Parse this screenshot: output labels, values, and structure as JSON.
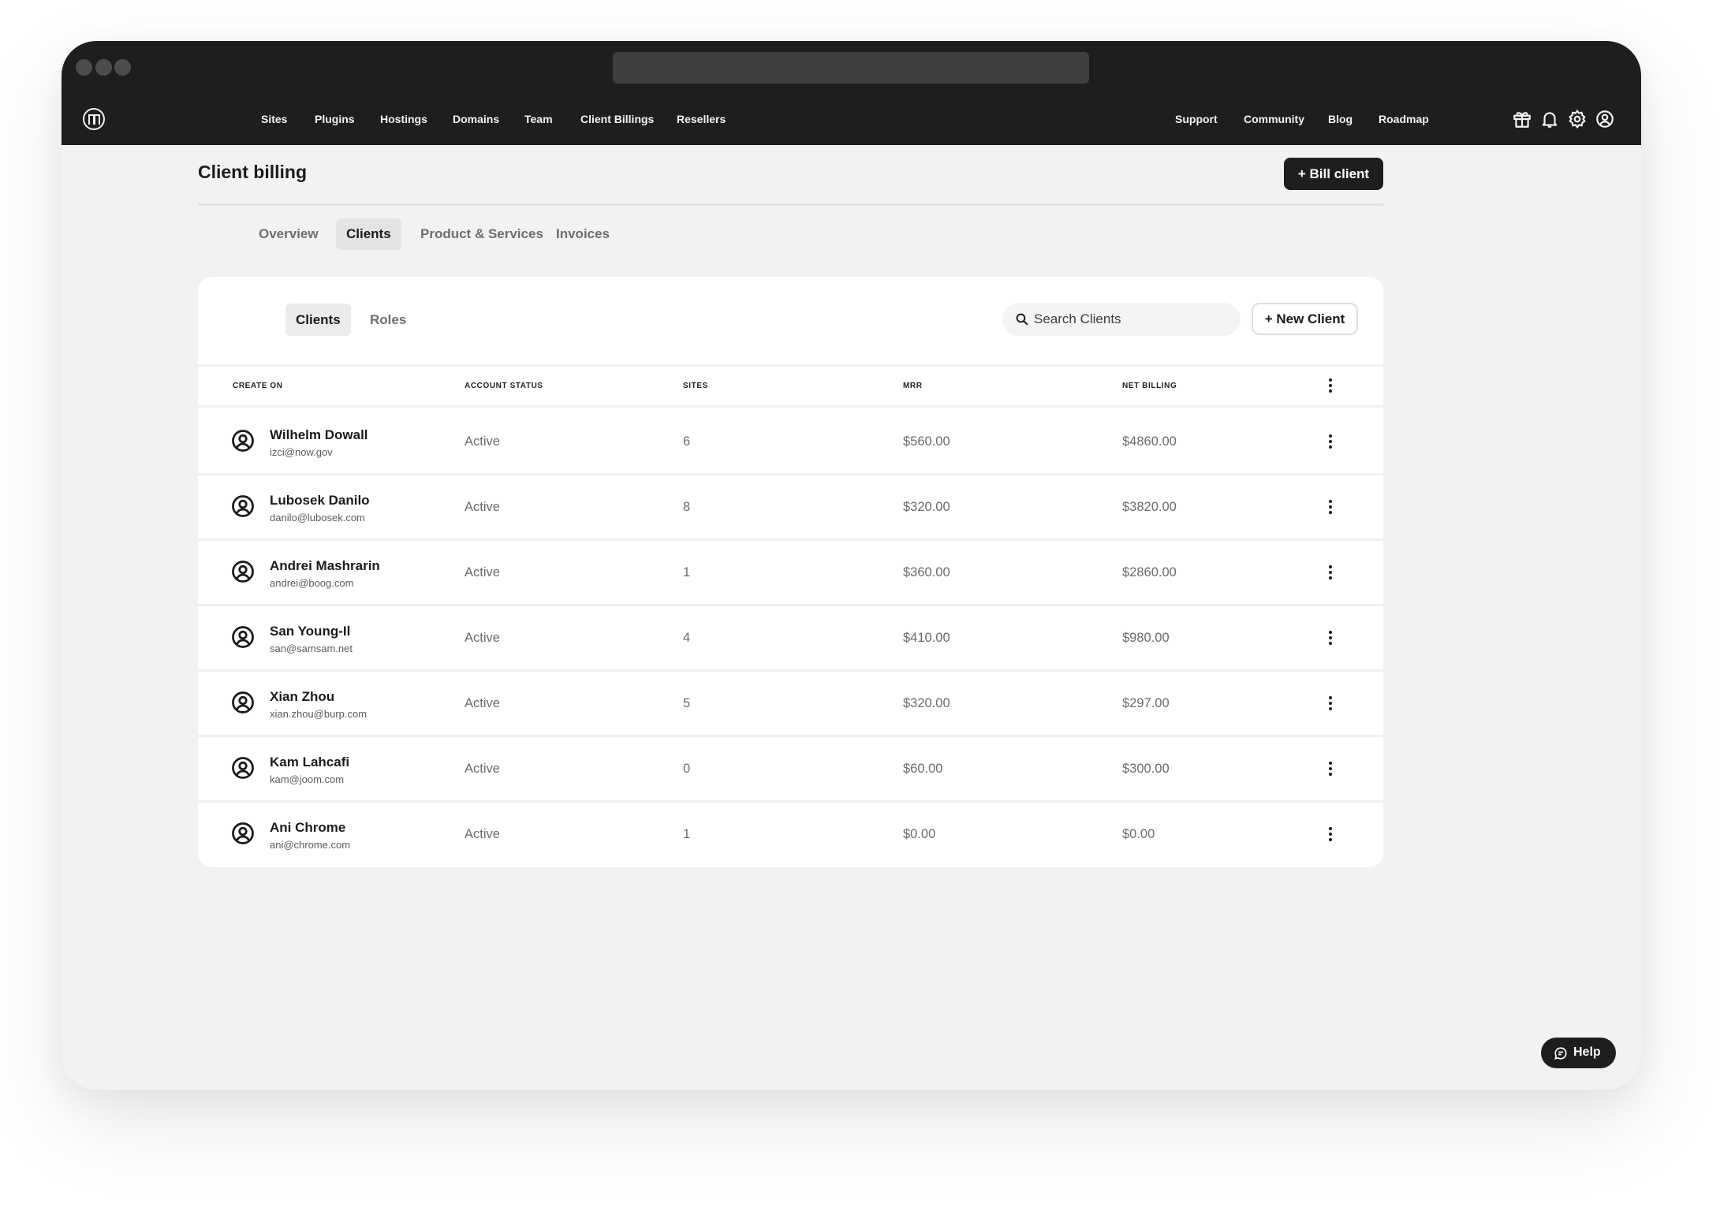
{
  "nav": {
    "left_items": [
      "Sites",
      "Plugins",
      "Hostings",
      "Domains",
      "Team",
      "Client Billings",
      "Resellers"
    ],
    "right_items": [
      "Support",
      "Community",
      "Blog",
      "Roadmap"
    ],
    "icons": [
      "gift-icon",
      "bell-icon",
      "gear-icon",
      "user-icon"
    ]
  },
  "page": {
    "title": "Client billing",
    "bill_button": "+ Bill client"
  },
  "tabs": [
    {
      "label": "Overview",
      "active": false
    },
    {
      "label": "Clients",
      "active": true
    },
    {
      "label": "Product & Services",
      "active": false
    },
    {
      "label": "Invoices",
      "active": false
    }
  ],
  "card": {
    "subtabs": [
      {
        "label": "Clients",
        "active": true
      },
      {
        "label": "Roles",
        "active": false
      }
    ],
    "search": {
      "placeholder": "Search Clients",
      "value": ""
    },
    "new_client_button": "+ New Client"
  },
  "table": {
    "columns": [
      "Create on",
      "Account status",
      "Sites",
      "MRR",
      "Net billing"
    ],
    "rows": [
      {
        "name": "Wilhelm Dowall",
        "email": "izci@now.gov",
        "status": "Active",
        "sites": "6",
        "mrr": "$560.00",
        "net": "$4860.00"
      },
      {
        "name": "Lubosek Danilo",
        "email": "danilo@lubosek.com",
        "status": "Active",
        "sites": "8",
        "mrr": "$320.00",
        "net": "$3820.00"
      },
      {
        "name": "Andrei Mashrarin",
        "email": "andrei@boog.com",
        "status": "Active",
        "sites": "1",
        "mrr": "$360.00",
        "net": "$2860.00"
      },
      {
        "name": "San Young-Il",
        "email": "san@samsam.net",
        "status": "Active",
        "sites": "4",
        "mrr": "$410.00",
        "net": "$980.00"
      },
      {
        "name": "Xian Zhou",
        "email": "xian.zhou@burp.com",
        "status": "Active",
        "sites": "5",
        "mrr": "$320.00",
        "net": "$297.00"
      },
      {
        "name": "Kam Lahcafi",
        "email": "kam@joom.com",
        "status": "Active",
        "sites": "0",
        "mrr": "$60.00",
        "net": "$300.00"
      },
      {
        "name": "Ani Chrome",
        "email": "ani@chrome.com",
        "status": "Active",
        "sites": "1",
        "mrr": "$0.00",
        "net": "$0.00"
      }
    ]
  },
  "help_button": "Help",
  "colors": {
    "nav_bg": "#1e1e1e",
    "page_bg": "#f2f2f3",
    "card_bg": "#ffffff",
    "active_tab_bg": "#e4e4e6",
    "primary_button": "#1e1e1e"
  }
}
